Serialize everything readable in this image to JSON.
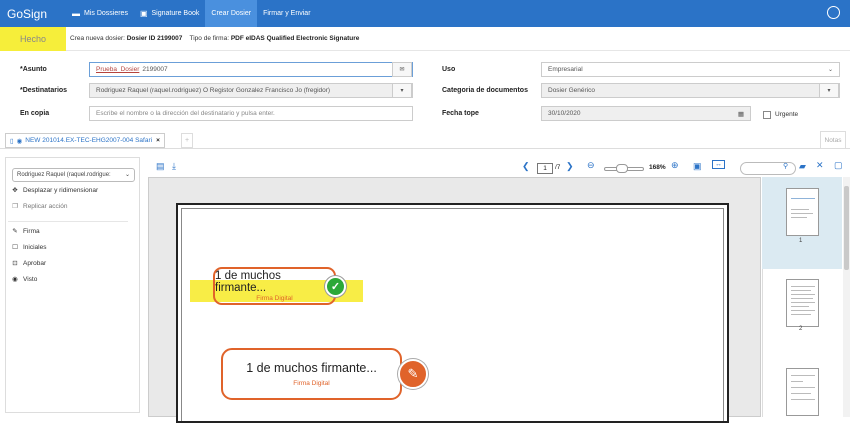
{
  "app": {
    "logo_main": "Go",
    "logo_sub": "Sign"
  },
  "nav": {
    "items": [
      {
        "label": "Mis Dossieres",
        "icon": "folder-icon"
      },
      {
        "label": "Signature Book",
        "icon": "book-icon"
      },
      {
        "label": "Crear Dosier",
        "active": true
      },
      {
        "label": "Firmar y Enviar"
      }
    ]
  },
  "status": {
    "badge": "Hecho",
    "prefix": "Crea nueva dosier:",
    "dossier": "Dosier ID 2199007",
    "type_label": "Tipo de firma:",
    "type_value": "PDF eIDAS Qualified Electronic Signature"
  },
  "form": {
    "asunto_label": "*Asunto",
    "asunto_link": "Prueba_Dosier",
    "asunto_rest": "2199007",
    "destinatarios_label": "*Destinatarios",
    "destinatarios_value": "Rodriguez Raquel (raquel.rodriguez) O Registor Gonzalez Francisco Jo (fregidor)",
    "encopia_label": "En copia",
    "encopia_placeholder": "Escribe el nombre o la dirección del destinatario y pulsa enter.",
    "uso_label": "Uso",
    "uso_value": "Empresarial",
    "categoria_label": "Categoria de documentos",
    "categoria_value": "Dosier Genérico",
    "fecha_label": "Fecha tope",
    "fecha_value": "30/10/2020",
    "urgente_label": "Urgente"
  },
  "tabs": {
    "doc": "NEW 201014.EX-TEC-EHG2007-004 Safari",
    "close": "×",
    "add": "+",
    "notas": "Notas"
  },
  "left": {
    "signer": "Rodriguez Raquel (raquel.rodrigue:",
    "items": [
      {
        "label": "Desplazar y ridimensionar",
        "icon": "move-icon"
      },
      {
        "label": "Replicar acción",
        "icon": "replicate-icon"
      },
      {
        "label": "Firma",
        "icon": "pen-icon"
      },
      {
        "label": "Iniciales",
        "icon": "initials-icon"
      },
      {
        "label": "Aprobar",
        "icon": "approve-icon"
      },
      {
        "label": "Visto",
        "icon": "eye-icon"
      }
    ]
  },
  "toolbar": {
    "page": "1",
    "total": "/7",
    "zoom": "168%"
  },
  "fields": [
    {
      "title": "1 de muchos firmante...",
      "sub": "Firma Digital",
      "state": "signed"
    },
    {
      "title": "1 de muchos firmante...",
      "sub": "Firma Digital",
      "state": "pending"
    }
  ],
  "thumbs": [
    {
      "num": "1"
    },
    {
      "num": "2"
    },
    {
      "num": ""
    }
  ],
  "colors": {
    "nav": "#2b73c7",
    "highlight": "#f6ee3a",
    "accent": "#e0632a",
    "ok": "#2ca838"
  }
}
